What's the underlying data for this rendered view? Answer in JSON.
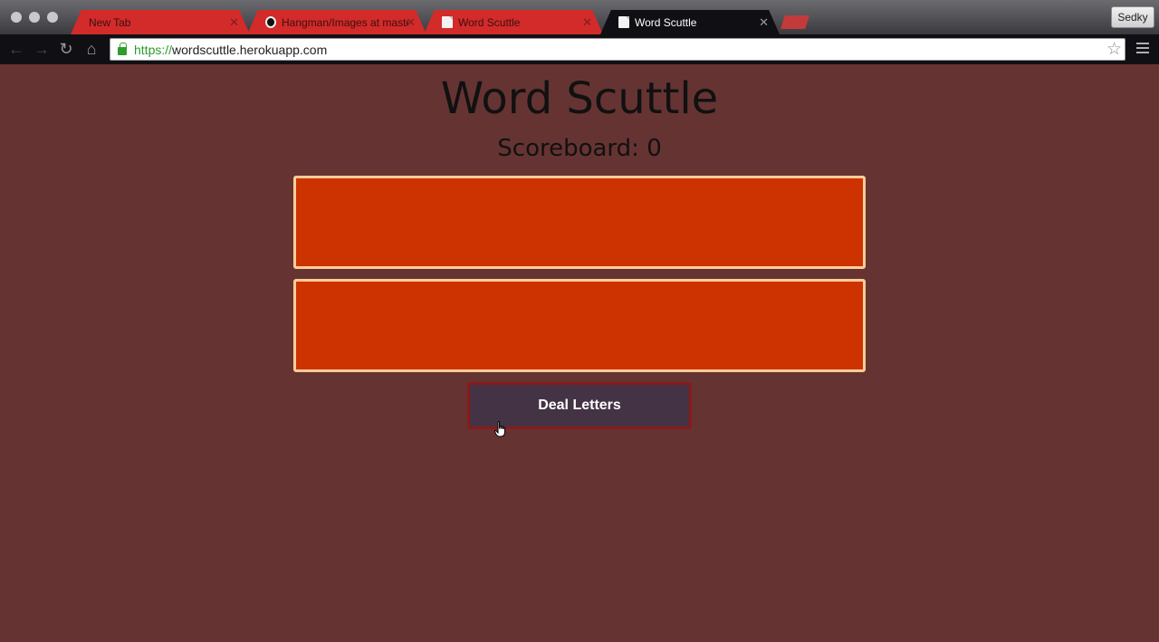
{
  "browser": {
    "tabs": [
      {
        "title": "New Tab",
        "favicon": "none"
      },
      {
        "title": "Hangman/Images at maste",
        "favicon": "github-icon"
      },
      {
        "title": "Word Scuttle",
        "favicon": "page-icon"
      },
      {
        "title": "Word Scuttle",
        "favicon": "page-icon",
        "active": true
      }
    ],
    "profile_name": "Sedky",
    "url_scheme": "https://",
    "url_host": "wordscuttle.herokuapp.com",
    "close_glyph": "✕",
    "star_glyph": "☆"
  },
  "page": {
    "title": "Word Scuttle",
    "scoreboard_label": "Scoreboard: 0",
    "deal_button_label": "Deal Letters",
    "colors": {
      "background": "#663333",
      "letter_box": "#cc3300",
      "letter_box_border": "#ffcc99",
      "button": "#443344",
      "button_border": "#8a1a1a"
    }
  }
}
